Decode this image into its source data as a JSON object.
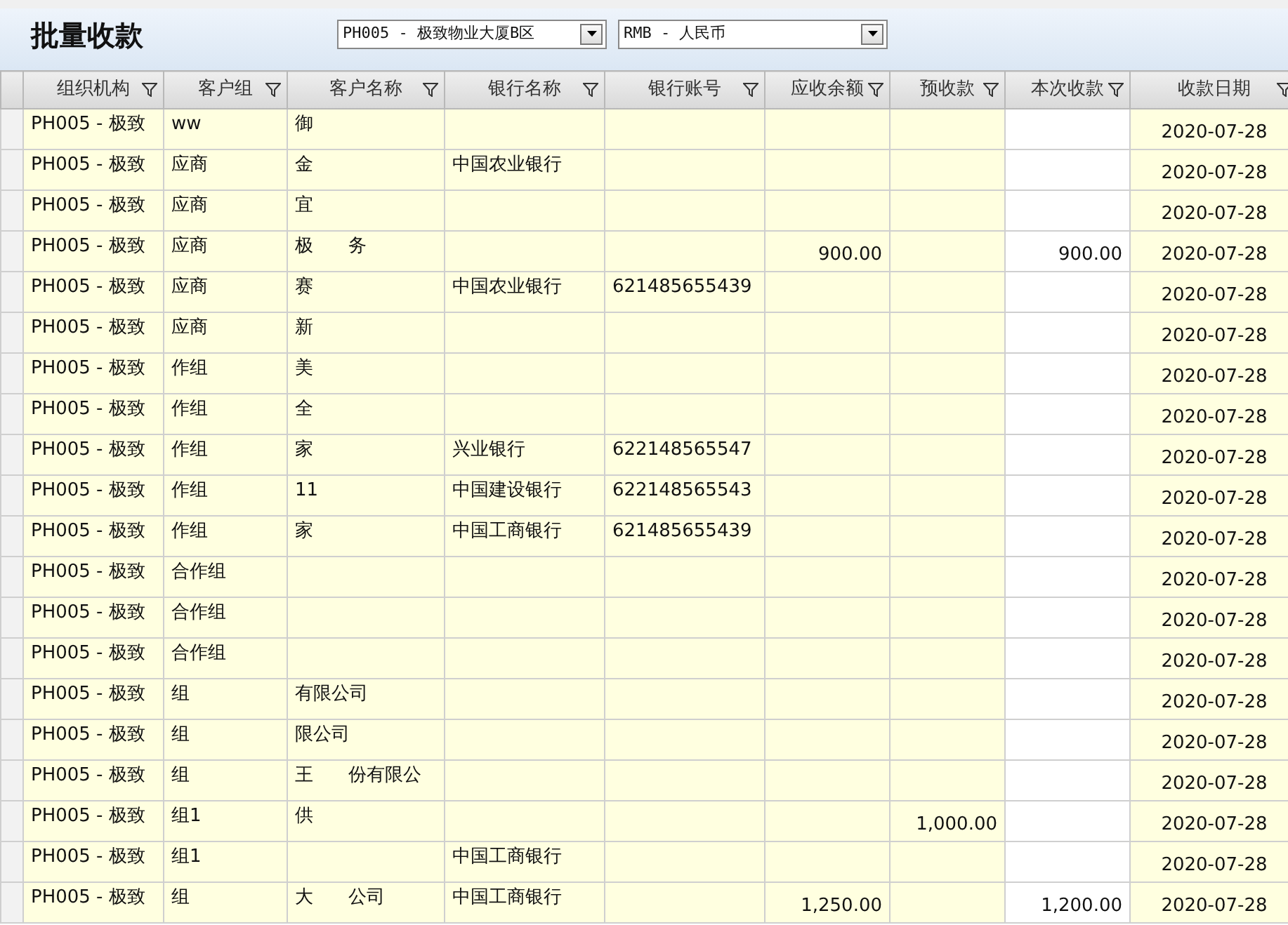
{
  "title": "批量收款",
  "filters": [
    {
      "value": "PH005 - 极致物业大厦B区"
    },
    {
      "value": "RMB - 人民币"
    }
  ],
  "table": {
    "columns": [
      {
        "label": "组织机构",
        "editable": false,
        "kind": "text"
      },
      {
        "label": "客户组",
        "editable": false,
        "kind": "text"
      },
      {
        "label": "客户名称",
        "editable": false,
        "kind": "text"
      },
      {
        "label": "银行名称",
        "editable": false,
        "kind": "text"
      },
      {
        "label": "银行账号",
        "editable": false,
        "kind": "text"
      },
      {
        "label": "应收余额",
        "editable": false,
        "kind": "amount"
      },
      {
        "label": "预收款",
        "editable": false,
        "kind": "amount"
      },
      {
        "label": "本次收款",
        "editable": true,
        "kind": "amount"
      },
      {
        "label": "收款日期",
        "editable": false,
        "kind": "date"
      }
    ],
    "rows": [
      [
        "PH005 - 极致",
        "ww",
        "御",
        "",
        "",
        "",
        "",
        "",
        "2020-07-28"
      ],
      [
        "PH005 - 极致",
        "应商",
        "金",
        "中国农业银行",
        "",
        "",
        "",
        "",
        "2020-07-28"
      ],
      [
        "PH005 - 极致",
        "应商",
        "宜",
        "",
        "",
        "",
        "",
        "",
        "2020-07-28"
      ],
      [
        "PH005 - 极致",
        "应商",
        "极      务",
        "",
        "",
        "900.00",
        "",
        "900.00",
        "2020-07-28"
      ],
      [
        "PH005 - 极致",
        "应商",
        "赛",
        "中国农业银行",
        "621485655439",
        "",
        "",
        "",
        "2020-07-28"
      ],
      [
        "PH005 - 极致",
        "应商",
        "新",
        "",
        "",
        "",
        "",
        "",
        "2020-07-28"
      ],
      [
        "PH005 - 极致",
        "作组",
        "美",
        "",
        "",
        "",
        "",
        "",
        "2020-07-28"
      ],
      [
        "PH005 - 极致",
        "作组",
        "全",
        "",
        "",
        "",
        "",
        "",
        "2020-07-28"
      ],
      [
        "PH005 - 极致",
        "作组",
        "家",
        "兴业银行",
        "622148565547",
        "",
        "",
        "",
        "2020-07-28"
      ],
      [
        "PH005 - 极致",
        "作组",
        "11",
        "中国建设银行",
        "622148565543",
        "",
        "",
        "",
        "2020-07-28"
      ],
      [
        "PH005 - 极致",
        "作组",
        "家",
        "中国工商银行",
        "621485655439",
        "",
        "",
        "",
        "2020-07-28"
      ],
      [
        "PH005 - 极致",
        "合作组",
        "",
        "",
        "",
        "",
        "",
        "",
        "2020-07-28"
      ],
      [
        "PH005 - 极致",
        "合作组",
        "",
        "",
        "",
        "",
        "",
        "",
        "2020-07-28"
      ],
      [
        "PH005 - 极致",
        "合作组",
        "",
        "",
        "",
        "",
        "",
        "",
        "2020-07-28"
      ],
      [
        "PH005 - 极致",
        "组",
        "有限公司",
        "",
        "",
        "",
        "",
        "",
        "2020-07-28"
      ],
      [
        "PH005 - 极致",
        "组",
        "限公司",
        "",
        "",
        "",
        "",
        "",
        "2020-07-28"
      ],
      [
        "PH005 - 极致",
        "组",
        "王      份有限公",
        "",
        "",
        "",
        "",
        "",
        "2020-07-28"
      ],
      [
        "PH005 - 极致",
        "组1",
        "供",
        "",
        "",
        "",
        "1,000.00",
        "",
        "2020-07-28"
      ],
      [
        "PH005 - 极致",
        "组1",
        "",
        "中国工商银行",
        "",
        "",
        "",
        "",
        "2020-07-28"
      ],
      [
        "PH005 - 极致",
        "组",
        "大      公司",
        "中国工商银行",
        "",
        "1,250.00",
        "",
        "1,200.00",
        "2020-07-28"
      ]
    ]
  }
}
